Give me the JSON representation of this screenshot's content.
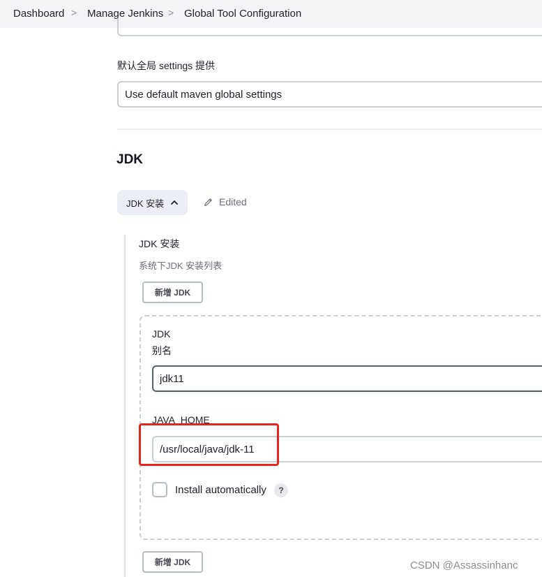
{
  "breadcrumb": {
    "items": [
      "Dashboard",
      "Manage Jenkins",
      "Global Tool Configuration"
    ],
    "separator": ">"
  },
  "maven_global_settings": {
    "label": "默认全局 settings 提供",
    "value": "Use default maven global settings"
  },
  "jdk_section": {
    "title": "JDK",
    "toggle_label": "JDK 安装",
    "edited_label": "Edited",
    "installations_label": "JDK 安装",
    "installations_desc": "系统下JDK 安装列表",
    "add_button": "新增 JDK",
    "entry": {
      "heading": "JDK",
      "alias_label": "别名",
      "alias_value": "jdk11",
      "java_home_label": "JAVA_HOME",
      "java_home_value": "/usr/local/java/jdk-11",
      "install_auto_label": "Install automatically",
      "help_glyph": "?"
    },
    "add_button_bottom": "新增 JDK"
  },
  "watermark": "CSDN @Assassinhanc",
  "colors": {
    "highlight_red": "#e8241c",
    "toggle_bg": "#ebeef5",
    "breadcrumb_bg": "#f4f4f6"
  },
  "icons": {
    "edited": "pencil-icon",
    "toggle": "chevron-up-icon",
    "help": "help-icon"
  }
}
